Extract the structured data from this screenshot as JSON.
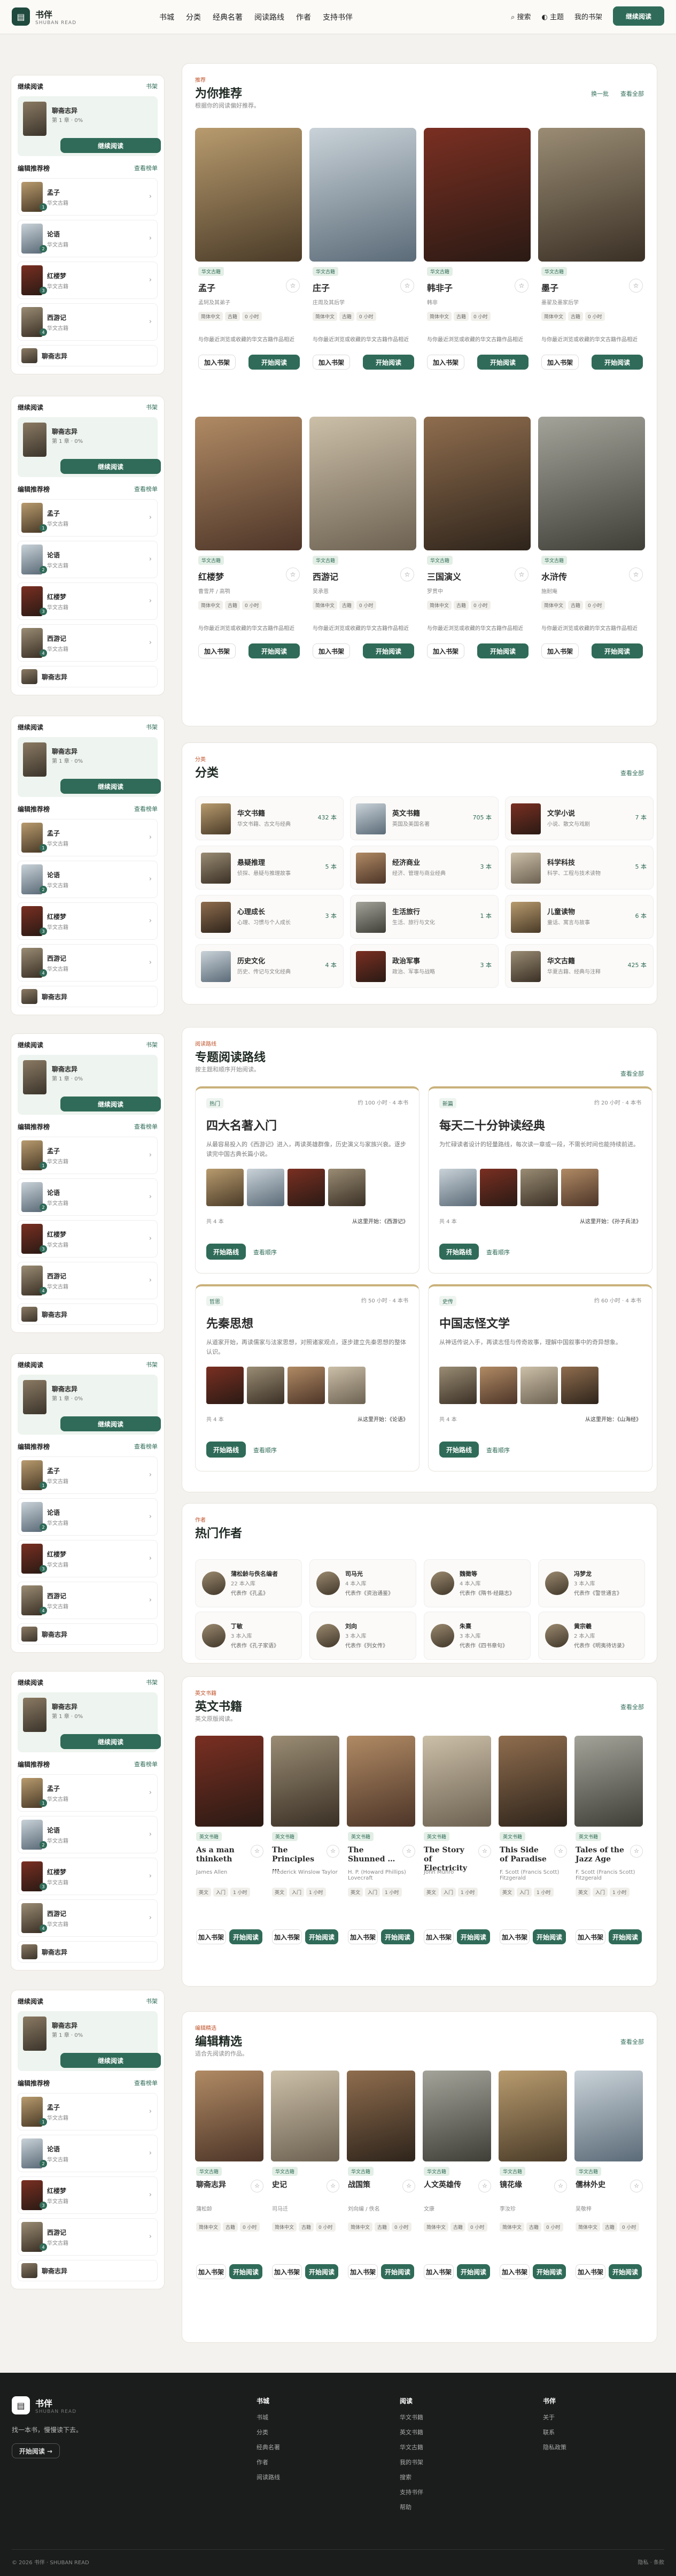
{
  "header": {
    "brand": "书伴",
    "brand_sub": "SHUBAN READ",
    "nav": [
      "书城",
      "分类",
      "经典名著",
      "阅读路线",
      "作者",
      "支持书伴"
    ],
    "search": "搜索",
    "theme": "主题",
    "mine": "我的书架",
    "cta": "继续阅读"
  },
  "sidebar": {
    "cont_title": "继续阅读",
    "cont_more": "书架",
    "cont_book": "聊斋志异",
    "cont_prog": "第 1 章 · 0%",
    "cont_btn": "继续阅读",
    "ed_title": "编辑推荐榜",
    "ed_more": "查看榜单",
    "items": [
      {
        "t": "孟子",
        "s": "华文古籍",
        "n": "1"
      },
      {
        "t": "论语",
        "s": "华文古籍",
        "n": "2"
      },
      {
        "t": "红楼梦",
        "s": "华文古籍",
        "n": "3"
      },
      {
        "t": "西游记",
        "s": "华文古籍",
        "n": "4"
      }
    ],
    "last": "聊斋志异"
  },
  "recommend": {
    "kicker": "推荐",
    "title": "为你推荐",
    "sub": "根据你的阅读偏好推荐。",
    "swap": "换一批",
    "more": "查看全部",
    "books": [
      {
        "t": "孟子",
        "a": "孟轲及其弟子",
        "badge": "华文古籍"
      },
      {
        "t": "庄子",
        "a": "庄周及其后学",
        "badge": "华文古籍"
      },
      {
        "t": "韩非子",
        "a": "韩非",
        "badge": "华文古籍"
      },
      {
        "t": "墨子",
        "a": "墨翟及墨家后学",
        "badge": "华文古籍"
      },
      {
        "t": "红楼梦",
        "a": "曹雪芹 / 高鹗",
        "badge": "华文古籍"
      },
      {
        "t": "西游记",
        "a": "吴承恩",
        "badge": "华文古籍"
      },
      {
        "t": "三国演义",
        "a": "罗贯中",
        "badge": "华文古籍"
      },
      {
        "t": "水浒传",
        "a": "施耐庵",
        "badge": "华文古籍"
      }
    ],
    "tags": [
      "简体中文",
      "古籍",
      "0 小时"
    ],
    "desc": "与你最近浏览或收藏的华文古籍作品相近",
    "add": "加入书架",
    "read": "开始阅读"
  },
  "categories": {
    "kicker": "分类",
    "title": "分类",
    "more": "查看全部",
    "items": [
      {
        "t": "华文书籍",
        "s": "华文书籍、古文与经典",
        "n": "432 本"
      },
      {
        "t": "英文书籍",
        "s": "英国及美国名著",
        "n": "705 本"
      },
      {
        "t": "文学小说",
        "s": "小说、散文与戏剧",
        "n": "7 本"
      },
      {
        "t": "悬疑推理",
        "s": "侦探、悬疑与推理故事",
        "n": "5 本"
      },
      {
        "t": "经济商业",
        "s": "经济、管理与商业经典",
        "n": "3 本"
      },
      {
        "t": "科学科技",
        "s": "科学、工程与技术读物",
        "n": "5 本"
      },
      {
        "t": "心理成长",
        "s": "心理、习惯与个人成长",
        "n": "3 本"
      },
      {
        "t": "生活旅行",
        "s": "生活、旅行与文化",
        "n": "1 本"
      },
      {
        "t": "儿童读物",
        "s": "童话、寓言与故事",
        "n": "6 本"
      },
      {
        "t": "历史文化",
        "s": "历史、传记与文化经典",
        "n": "4 本"
      },
      {
        "t": "政治军事",
        "s": "政治、军事与战略",
        "n": "3 本"
      },
      {
        "t": "华文古籍",
        "s": "华夏古籍、经典与注释",
        "n": "425 本"
      }
    ]
  },
  "routes": {
    "kicker": "阅读路线",
    "title": "专题阅读路线",
    "sub": "按主题和顺序开始阅读。",
    "more": "查看全部",
    "items": [
      {
        "k": "热门",
        "m": "约 100 小时 · 4 本书",
        "t": "四大名著入门",
        "d": "从最容易投入的《西游记》进入，再读英雄群像，历史演义与家族兴衰。逐步读完中国古典长篇小说。",
        "n": "共 4 本",
        "f": "从这里开始：《西游记》"
      },
      {
        "k": "新篇",
        "m": "约 20 小时 · 4 本书",
        "t": "每天二十分钟读经典",
        "d": "为忙碌读者设计的轻量路线，每次读一章或一段，不需长时间也能持续前进。",
        "n": "共 4 本",
        "f": "从这里开始：《孙子兵法》"
      },
      {
        "k": "哲思",
        "m": "约 50 小时 · 4 本书",
        "t": "先秦思想",
        "d": "从道家开始，再读儒家与法家思想，对照诸家观点，逐步建立先秦思想的整体认识。",
        "n": "共 4 本",
        "f": "从这里开始：《论语》"
      },
      {
        "k": "史传",
        "m": "约 60 小时 · 4 本书",
        "t": "中国志怪文学",
        "d": "从神话传说入手，再读志怪与传奇故事，理解中国叙事中的奇异想象。",
        "n": "共 4 本",
        "f": "从这里开始：《山海经》"
      }
    ],
    "start": "开始路线",
    "detail": "查看顺序"
  },
  "authors": {
    "kicker": "作者",
    "title": "热门作者",
    "items": [
      {
        "n": "蒲松龄与佚名编者",
        "c": "22 本入库",
        "w": "代表作《孔孟》"
      },
      {
        "n": "司马光",
        "c": "4 本入库",
        "w": "代表作《资治通鉴》"
      },
      {
        "n": "魏徵等",
        "c": "4 本入库",
        "w": "代表作《隋书·经籍志》"
      },
      {
        "n": "冯梦龙",
        "c": "3 本入库",
        "w": "代表作《警世通言》"
      },
      {
        "n": "丁敏",
        "c": "3 本入库",
        "w": "代表作《孔子家语》"
      },
      {
        "n": "刘向",
        "c": "3 本入库",
        "w": "代表作《列女传》"
      },
      {
        "n": "朱熹",
        "c": "3 本入库",
        "w": "代表作《四书章句》"
      },
      {
        "n": "黄宗羲",
        "c": "2 本入库",
        "w": "代表作《明夷待访录》"
      }
    ]
  },
  "english": {
    "kicker": "英文书籍",
    "title": "英文书籍",
    "sub": "英文原版阅读。",
    "more": "查看全部",
    "books": [
      {
        "t": "As a man thinketh",
        "a": "James Allen"
      },
      {
        "t": "The Principles …",
        "a": "Frederick Winslow Taylor"
      },
      {
        "t": "The Shunned …",
        "a": "H. P. (Howard Phillips) Lovecraft"
      },
      {
        "t": "The Story of Electricity",
        "a": "John Munro"
      },
      {
        "t": "This Side of Paradise",
        "a": "F. Scott (Francis Scott) Fitzgerald"
      },
      {
        "t": "Tales of the Jazz Age",
        "a": "F. Scott (Francis Scott) Fitzgerald"
      }
    ],
    "badge": "英文书籍",
    "tags": [
      "英文",
      "入门",
      "1 小时"
    ],
    "add": "加入书架",
    "read": "开始阅读"
  },
  "editors": {
    "kicker": "编辑精选",
    "title": "编辑精选",
    "sub": "适合先阅读的作品。",
    "more": "查看全部",
    "books": [
      {
        "t": "聊斋志异",
        "a": "蒲松龄"
      },
      {
        "t": "史记",
        "a": "司马迁"
      },
      {
        "t": "战国策",
        "a": "刘向编 / 佚名"
      },
      {
        "t": "人文英雄传",
        "a": "文康"
      },
      {
        "t": "镜花缘",
        "a": "李汝珍"
      },
      {
        "t": "儒林外史",
        "a": "吴敬梓"
      }
    ],
    "badge": "华文古籍",
    "tags": [
      "简体中文",
      "古籍",
      "0 小时"
    ],
    "add": "加入书架",
    "read": "开始阅读"
  },
  "footer": {
    "brand": "书伴",
    "brand_sub": "SHUBAN READ",
    "tagline": "找一本书，慢慢读下去。",
    "cta": "开始阅读 →",
    "cols": [
      {
        "h": "书城",
        "items": [
          "书城",
          "分类",
          "经典名著",
          "作者",
          "阅读路线"
        ]
      },
      {
        "h": "阅读",
        "items": [
          "华文书籍",
          "英文书籍",
          "华文古籍",
          "我的书架",
          "搜索",
          "支持书伴",
          "帮助"
        ]
      },
      {
        "h": "书伴",
        "items": [
          "关于",
          "联系",
          "隐私政策"
        ]
      }
    ],
    "copy": "© 2026 书伴 · SHUBAN READ",
    "links": "隐私 · 条款"
  }
}
